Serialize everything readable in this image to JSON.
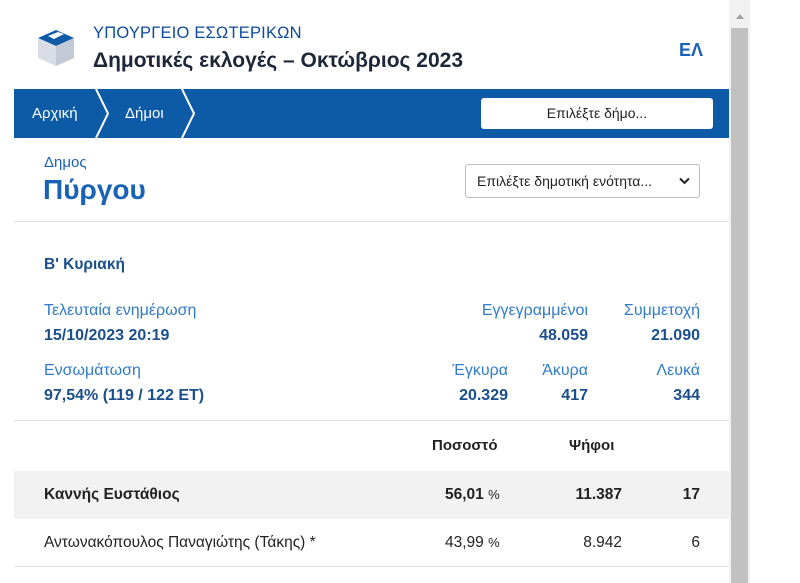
{
  "header": {
    "ministry": "ΥΠΟΥΡΓΕΙΟ ΕΣΩΤΕΡΙΚΩΝ",
    "title": "Δημοτικές εκλογές – Οκτώβριος 2023",
    "lang": "ΕΛ",
    "logo_icon": "ballot-box-icon"
  },
  "nav": {
    "crumbs": [
      "Αρχική",
      "Δήμοι"
    ],
    "municipality_select": "Επιλέξτε δήμο..."
  },
  "municipality": {
    "label": "Δημος",
    "name": "Πύργου",
    "unit_select": "Επιλέξτε δημοτική ενότητα..."
  },
  "round": "Β' Κυριακή",
  "stats": {
    "last_update": {
      "label": "Τελευταία ενημέρωση",
      "value": "15/10/2023 20:19"
    },
    "registered": {
      "label": "Εγγεγραμμένοι",
      "value": "48.059"
    },
    "turnout": {
      "label": "Συμμετοχή",
      "value": "21.090"
    },
    "integration": {
      "label": "Ενσωμάτωση",
      "value": "97,54% (119 / 122 ΕΤ)"
    },
    "valid": {
      "label": "Έγκυρα",
      "value": "20.329"
    },
    "invalid": {
      "label": "Άκυρα",
      "value": "417"
    },
    "blank": {
      "label": "Λευκά",
      "value": "344"
    }
  },
  "table": {
    "headers": {
      "percent": "Ποσοστό",
      "votes": "Ψήφοι"
    },
    "rows": [
      {
        "name": "Καννής Ευστάθιος",
        "percent": "56,01",
        "pct_sign": "%",
        "votes": "11.387",
        "seats": "17"
      },
      {
        "name": "Αντωνακόπουλος Παναγιώτης (Τάκης) *",
        "percent": "43,99",
        "pct_sign": "%",
        "votes": "8.942",
        "seats": "6"
      }
    ]
  },
  "colors": {
    "navbar": "#0d5aa7",
    "accent": "#1a62b5",
    "value": "#1a4f8c",
    "label": "#2f7bc7"
  }
}
